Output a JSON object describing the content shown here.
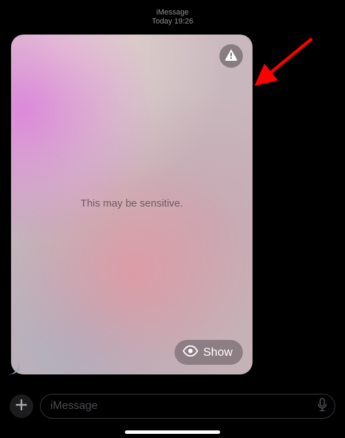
{
  "header": {
    "service": "iMessage",
    "timestamp": "Today 19:26"
  },
  "bubble": {
    "sensitive_label": "This may be sensitive.",
    "show_label": "Show",
    "warning_icon": "warning-triangle",
    "show_icon": "eye"
  },
  "composer": {
    "placeholder": "iMessage",
    "plus_icon": "plus",
    "mic_icon": "microphone"
  },
  "annotation": {
    "arrow_color": "#ff0000"
  }
}
